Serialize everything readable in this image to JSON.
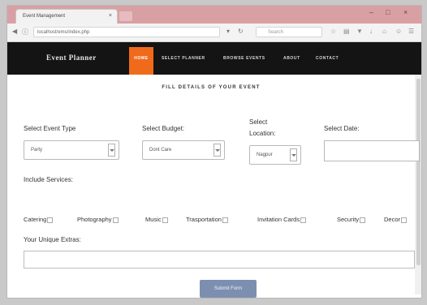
{
  "browser": {
    "tab_title": "Event Management",
    "tab_close": "×",
    "window_controls": [
      "–",
      "□",
      "×"
    ],
    "url": "localhost/ems/index.php",
    "search_placeholder": "Search",
    "icons": [
      "back-icon",
      "info-icon",
      "reload-icon",
      "star-icon",
      "clipboard-icon",
      "download-icon",
      "home-icon",
      "menu-icon"
    ]
  },
  "site": {
    "brand": "Event Planner",
    "nav": [
      "HOME",
      "SELECT PLANNER",
      "BROWSE EVENTS",
      "ABOUT",
      "CONTACT"
    ],
    "active_color": "#f06a1c"
  },
  "form": {
    "heading": "FILL DETAILS OF YOUR EVENT",
    "event_type_label": "Select Event Type",
    "event_type_value": "Party",
    "budget_label": "Select Budget:",
    "budget_value": "Dont Care",
    "location_label_1": "Select",
    "location_label_2": "Location:",
    "location_value": "Nagpur",
    "date_label": "Select Date:",
    "services_label": "Include Services:",
    "services": [
      "Catering",
      "Photography",
      "Music",
      "Trasportation",
      "Invitation Cards",
      "Security",
      "Decor"
    ],
    "extras_label": "Your Unique Extras:",
    "submit_label": "Submit Form",
    "submit_color": "#7d8fb0"
  }
}
